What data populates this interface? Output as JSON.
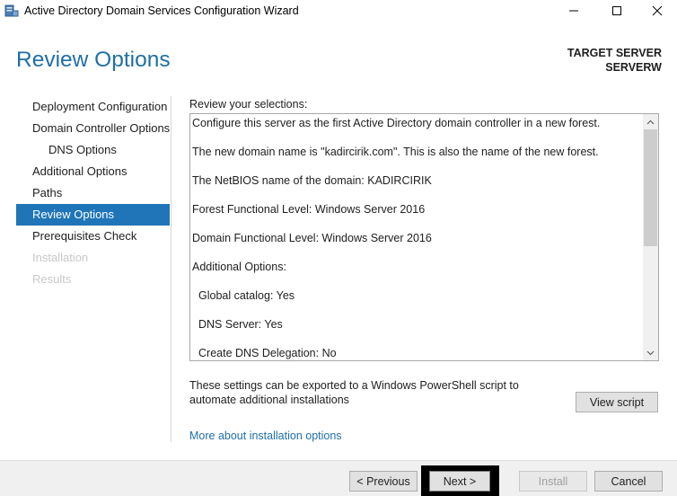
{
  "window": {
    "title": "Active Directory Domain Services Configuration Wizard",
    "icon": "ad-server-icon"
  },
  "header": {
    "page_title": "Review Options",
    "target_label": "TARGET SERVER",
    "target_server": "SERVERW"
  },
  "nav": {
    "items": [
      {
        "label": "Deployment Configuration",
        "state": "normal",
        "level": 0
      },
      {
        "label": "Domain Controller Options",
        "state": "normal",
        "level": 0
      },
      {
        "label": "DNS Options",
        "state": "normal",
        "level": 1
      },
      {
        "label": "Additional Options",
        "state": "normal",
        "level": 0
      },
      {
        "label": "Paths",
        "state": "normal",
        "level": 0
      },
      {
        "label": "Review Options",
        "state": "active",
        "level": 0
      },
      {
        "label": "Prerequisites Check",
        "state": "normal",
        "level": 0
      },
      {
        "label": "Installation",
        "state": "disabled",
        "level": 0
      },
      {
        "label": "Results",
        "state": "disabled",
        "level": 0
      }
    ]
  },
  "review": {
    "label": "Review your selections:",
    "lines": [
      "Configure this server as the first Active Directory domain controller in a new forest.",
      "The new domain name is \"kadircirik.com\". This is also the name of the new forest.",
      "The NetBIOS name of the domain: KADIRCIRIK",
      "Forest Functional Level: Windows Server 2016",
      "Domain Functional Level: Windows Server 2016",
      "Additional Options:",
      "Global catalog: Yes",
      "DNS Server: Yes",
      "Create DNS Delegation: No"
    ]
  },
  "export": {
    "text": "These settings can be exported to a Windows PowerShell script to automate additional installations",
    "view_script_label": "View script"
  },
  "more_link": "More about installation options",
  "footer": {
    "previous_label": "< Previous",
    "next_label": "Next >",
    "install_label": "Install",
    "cancel_label": "Cancel"
  },
  "colors": {
    "accent": "#1f6fa8",
    "nav_active": "#1f75b8",
    "disabled_text": "#c8c8c8",
    "footer_bg": "#f0f0f0"
  }
}
